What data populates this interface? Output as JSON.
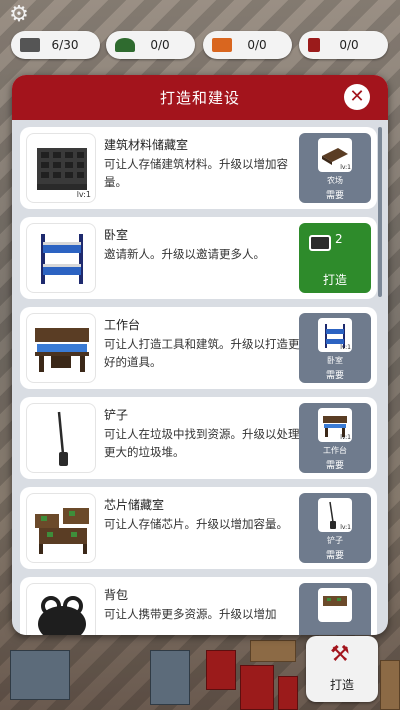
{
  "resources": [
    {
      "icon": "scrap-metal-icon",
      "value": "6/30",
      "color": "#555555"
    },
    {
      "icon": "plant-icon",
      "value": "0/0",
      "color": "#2f6b2f"
    },
    {
      "icon": "carrot-icon",
      "value": "0/0",
      "color": "#d9661f"
    },
    {
      "icon": "red-chip-icon",
      "value": "0/0",
      "color": "#9b1b1b"
    }
  ],
  "panel": {
    "title": "打造和建设",
    "accent": "#a3141c",
    "items": [
      {
        "name": "建筑材料储藏室",
        "desc": "可让人存储建筑材料。升级以增加容量。",
        "level": "lv:1",
        "action": "requirement",
        "req_sub": "农场",
        "req_level": "lv:1",
        "req_label": "需要"
      },
      {
        "name": "卧室",
        "desc": "邀请新人。升级以邀请更多人。",
        "level": "",
        "action": "craft",
        "cost": "2",
        "craft_label": "打造"
      },
      {
        "name": "工作台",
        "desc": "可让人打造工具和建筑。升级以打造更好的道具。",
        "level": "",
        "action": "requirement",
        "req_sub": "卧室",
        "req_level": "lv:1",
        "req_label": "需要"
      },
      {
        "name": "铲子",
        "desc": "可让人在垃圾中找到资源。升级以处理更大的垃圾堆。",
        "level": "",
        "action": "requirement",
        "req_sub": "工作台",
        "req_level": "lv:1",
        "req_label": "需要"
      },
      {
        "name": "芯片储藏室",
        "desc": "可让人存储芯片。升级以增加容量。",
        "level": "",
        "action": "requirement",
        "req_sub": "铲子",
        "req_level": "lv:1",
        "req_label": "需要"
      },
      {
        "name": "背包",
        "desc": "可让人携带更多资源。升级以增加",
        "level": "",
        "action": "requirement",
        "req_sub": "",
        "req_level": "",
        "req_label": ""
      }
    ]
  },
  "bottom_button": {
    "label": "打造",
    "icon": "tools-icon"
  }
}
